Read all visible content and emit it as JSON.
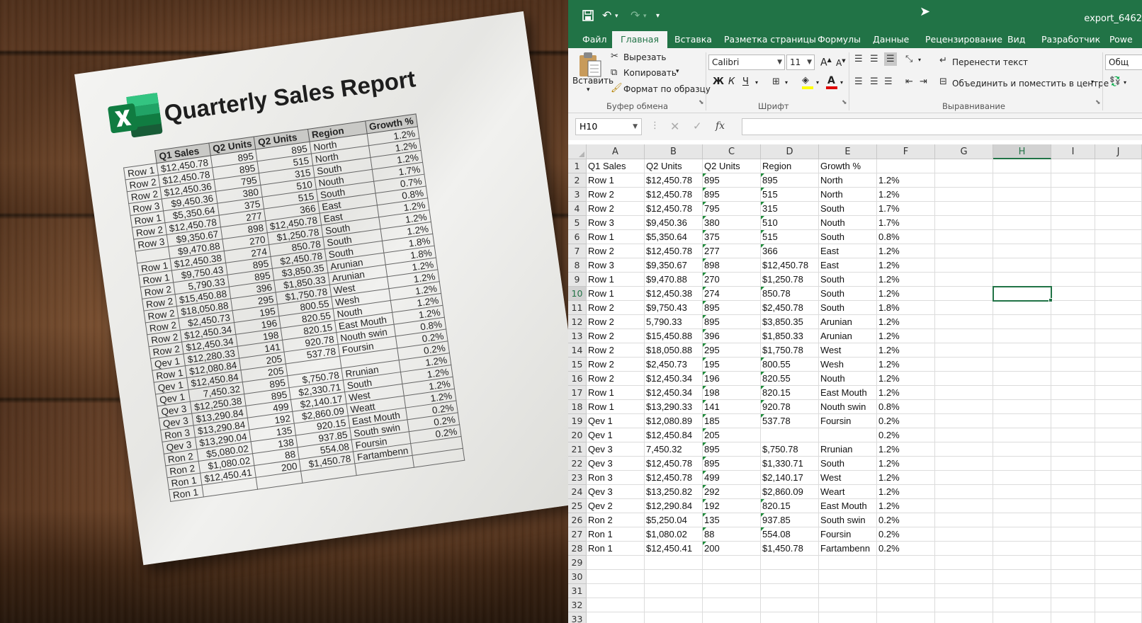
{
  "paper": {
    "title": "Quarterly Sales Report",
    "headers": [
      "",
      "Q1 Sales",
      "Q2 Units",
      "Q2 Units",
      "Region",
      "Growth %"
    ],
    "rows": [
      [
        "Row 1",
        "$12,450.78",
        "895",
        "895",
        "North",
        "1.2%"
      ],
      [
        "Row 2",
        "$12,450.78",
        "895",
        "515",
        "North",
        "1.2%"
      ],
      [
        "Row 2",
        "$12,450.36",
        "795",
        "315",
        "South",
        "1.2%"
      ],
      [
        "Row 3",
        "$9,450.36",
        "380",
        "510",
        "Nouth",
        "1.7%"
      ],
      [
        "Row 1",
        "$5,350.64",
        "375",
        "515",
        "South",
        "0.7%"
      ],
      [
        "Row 2",
        "$12,450.78",
        "277",
        "366",
        "East",
        "0.8%"
      ],
      [
        "Row 3",
        "$9,350.67",
        "898",
        "$12,450.78",
        "East",
        "1.2%"
      ],
      [
        "",
        "$9,470.88",
        "270",
        "$1,250.78",
        "South",
        "1.2%"
      ],
      [
        "Row 1",
        "$12,450.38",
        "274",
        "850.78",
        "South",
        "1.2%"
      ],
      [
        "Row 1",
        "$9,750.43",
        "895",
        "$2,450.78",
        "South",
        "1.8%"
      ],
      [
        "Row 2",
        "5,790.33",
        "895",
        "$3,850.35",
        "Arunian",
        "1.8%"
      ],
      [
        "Row 2",
        "$15,450.88",
        "396",
        "$1,850.33",
        "Arunian",
        "1.2%"
      ],
      [
        "Row 2",
        "$18,050.88",
        "295",
        "$1,750.78",
        "West",
        "1.2%"
      ],
      [
        "Row 2",
        "$2,450.73",
        "195",
        "800.55",
        "Wesh",
        "1.2%"
      ],
      [
        "Row 2",
        "$12,450.34",
        "196",
        "820.55",
        "Nouth",
        "1.2%"
      ],
      [
        "Row 2",
        "$12,450.34",
        "198",
        "820.15",
        "East Mouth",
        "1.2%"
      ],
      [
        "Qev 1",
        "$12,280.33",
        "141",
        "920.78",
        "Nouth swin",
        "0.8%"
      ],
      [
        "Row 1",
        "$12,080.84",
        "205",
        "537.78",
        "Foursin",
        "0.2%"
      ],
      [
        "Qev 1",
        "$12,450.84",
        "205",
        "",
        "",
        "0.2%"
      ],
      [
        "Qev 1",
        "7,450.32",
        "895",
        "$,750.78",
        "Rrunian",
        "1.2%"
      ],
      [
        "Qev 3",
        "$12,250.38",
        "895",
        "$2,330.71",
        "South",
        "1.2%"
      ],
      [
        "Qev 3",
        "$13,290.84",
        "499",
        "$2,140.17",
        "West",
        "1.2%"
      ],
      [
        "Ron 3",
        "$13,290.84",
        "192",
        "$2,860.09",
        "Weatt",
        "1.2%"
      ],
      [
        "Qev 3",
        "$13,290.04",
        "135",
        "920.15",
        "East Mouth",
        "0.2%"
      ],
      [
        "Ron 2",
        "$5,080.02",
        "138",
        "937.85",
        "South swin",
        "0.2%"
      ],
      [
        "Ron 2",
        "$1,080.02",
        "88",
        "554.08",
        "Foursin",
        "0.2%"
      ],
      [
        "Ron 1",
        "$12,450.41",
        "200",
        "$1,450.78",
        "Fartambenn",
        ""
      ],
      [
        "Ron 1",
        "",
        "",
        "",
        "",
        ""
      ]
    ]
  },
  "excel": {
    "doc_title": "export_6462",
    "tabs": [
      "Файл",
      "Главная",
      "Вставка",
      "Разметка страницы",
      "Формулы",
      "Данные",
      "Рецензирование",
      "Вид",
      "Разработчик",
      "Powe"
    ],
    "active_tab": "Главная",
    "ribbon": {
      "paste": "Вставить",
      "cut": "Вырезать",
      "copy": "Копировать",
      "format_painter": "Формат по образцу",
      "clipboard_group": "Буфер обмена",
      "font_name": "Calibri",
      "font_size": "11",
      "bold": "Ж",
      "italic": "К",
      "underline": "Ч",
      "font_group": "Шрифт",
      "wrap_text": "Перенести текст",
      "merge_center": "Объединить и поместить в центре",
      "alignment_group": "Выравнивание",
      "number_format": "Общ"
    },
    "name_box": "H10",
    "fx": "fx",
    "selected_cell": "H10",
    "columns": [
      "A",
      "B",
      "C",
      "D",
      "E",
      "F",
      "G",
      "H",
      "I",
      "J"
    ],
    "row_numbers": [
      "1",
      "2",
      "3",
      "4",
      "5",
      "6",
      "7",
      "8",
      "9",
      "10",
      "11",
      "12",
      "13",
      "14",
      "15",
      "16",
      "17",
      "18",
      "19",
      "20",
      "21",
      "22",
      "23",
      "24",
      "25",
      "26",
      "27",
      "28",
      "29",
      "30",
      "31",
      "32",
      "33"
    ],
    "rows": [
      [
        "Q1 Sales",
        "Q2 Units",
        "Q2 Units",
        "Region",
        "Growth %",
        ""
      ],
      [
        "Row 1",
        "$12,450.78",
        "895",
        "895",
        "North",
        "1.2%"
      ],
      [
        "Row 2",
        "$12,450.78",
        "895",
        "515",
        "North",
        "1.2%"
      ],
      [
        "Row 2",
        "$12,450.78",
        "795",
        "315",
        "South",
        "1.7%"
      ],
      [
        "Row 3",
        "$9,450.36",
        "380",
        "510",
        "Nouth",
        "1.7%"
      ],
      [
        "Row 1",
        "$5,350.64",
        "375",
        "515",
        "South",
        "0.8%"
      ],
      [
        "Row 2",
        "$12,450.78",
        "277",
        "366",
        "East",
        "1.2%"
      ],
      [
        "Row 3",
        "$9,350.67",
        "898",
        "$12,450.78",
        "East",
        "1.2%"
      ],
      [
        "Row 1",
        "$9,470.88",
        "270",
        "$1,250.78",
        "South",
        "1.2%"
      ],
      [
        "Row 1",
        "$12,450.38",
        "274",
        "850.78",
        "South",
        "1.2%"
      ],
      [
        "Row 2",
        "$9,750.43",
        "895",
        "$2,450.78",
        "South",
        "1.8%"
      ],
      [
        "Row 2",
        "5,790.33",
        "895",
        "$3,850.35",
        "Arunian",
        "1.2%"
      ],
      [
        "Row 2",
        "$15,450.88",
        "396",
        "$1,850.33",
        "Arunian",
        "1.2%"
      ],
      [
        "Row 2",
        "$18,050.88",
        "295",
        "$1,750.78",
        "West",
        "1.2%"
      ],
      [
        "Row 2",
        "$2,450.73",
        "195",
        "800.55",
        "Wesh",
        "1.2%"
      ],
      [
        "Row 2",
        "$12,450.34",
        "196",
        "820.55",
        "Nouth",
        "1.2%"
      ],
      [
        "Row 1",
        "$12,450.34",
        "198",
        "820.15",
        "East Mouth",
        "1.2%"
      ],
      [
        "Row 1",
        "$13,290.33",
        "141",
        "920.78",
        "Nouth swin",
        "0.8%"
      ],
      [
        "Qev 1",
        "$12,080.89",
        "185",
        "537.78",
        "Foursin",
        "0.2%"
      ],
      [
        "Qev 1",
        "$12,450.84",
        "205",
        "",
        "",
        "0.2%"
      ],
      [
        "Qev 3",
        "7,450.32",
        "895",
        "$,750.78",
        "Rrunian",
        "1.2%"
      ],
      [
        "Qev 3",
        "$12,450.78",
        "895",
        "$1,330.71",
        "South",
        "1.2%"
      ],
      [
        "Ron 3",
        "$12,450.78",
        "499",
        "$2,140.17",
        "West",
        "1.2%"
      ],
      [
        "Qev 3",
        "$13,250.82",
        "292",
        "$2,860.09",
        "Weart",
        "1.2%"
      ],
      [
        "Qev 2",
        "$12,290.84",
        "192",
        "820.15",
        "East Mouth",
        "1.2%"
      ],
      [
        "Ron 2",
        "$5,250.04",
        "135",
        "937.85",
        "South swin",
        "0.2%"
      ],
      [
        "Ron 1",
        "$1,080.02",
        "88",
        "554.08",
        "Foursin",
        "0.2%"
      ],
      [
        "Ron 1",
        "$12,450.41",
        "200",
        "$1,450.78",
        "Fartambenn",
        "0.2%"
      ]
    ]
  }
}
